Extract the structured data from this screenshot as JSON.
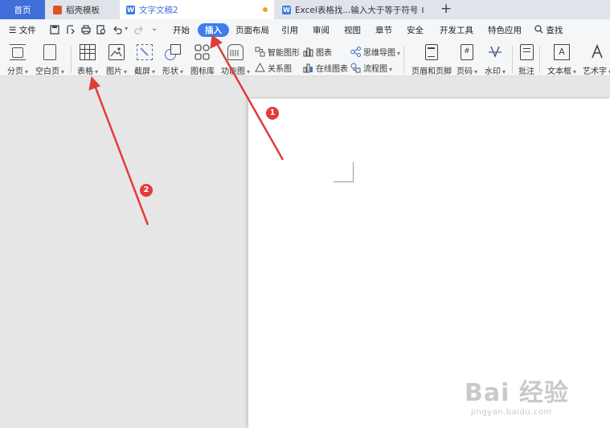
{
  "tabs": {
    "home": "首页",
    "template": "稻壳模板",
    "doc": "文字文稿2",
    "excel": "Excel表格找...输入大于等于符号",
    "new_tab": "+"
  },
  "menu": {
    "file": "文件",
    "items": [
      "开始",
      "插入",
      "页面布局",
      "引用",
      "审阅",
      "视图",
      "章节",
      "安全",
      "开发工具",
      "特色应用"
    ],
    "active": "插入",
    "search": "查找"
  },
  "ribbon": {
    "break": "分页",
    "blank_page": "空白页",
    "table": "表格",
    "picture": "图片",
    "screenshot": "截屏",
    "shapes": "形状",
    "icon_library": "图标库",
    "function_chart": "功能图",
    "smart_art": "智能图形",
    "chart": "图表",
    "mind_map": "思维导图",
    "relation_chart": "关系图",
    "online_chart": "在线图表",
    "flowchart": "流程图",
    "header_footer": "页眉和页脚",
    "page_number": "页码",
    "watermark": "水印",
    "comment": "批注",
    "text_box": "文本框",
    "word_art": "艺术字"
  },
  "annotations": {
    "marker1": "1",
    "marker2": "2"
  },
  "watermark": {
    "brand": "Bai  经验",
    "url": "jingyan.baidu.com"
  },
  "colors": {
    "accent": "#3e7ded",
    "home_tab": "#3f6fd8",
    "annotation": "#e23b3b"
  }
}
